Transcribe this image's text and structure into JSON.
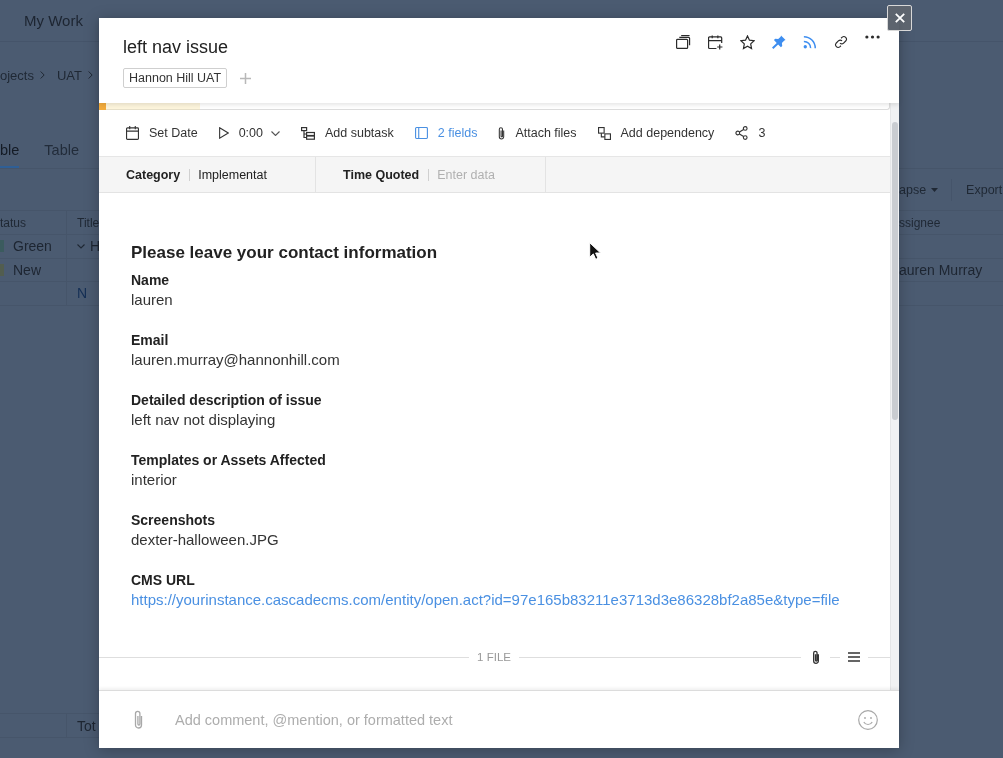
{
  "background_app": {
    "nav_title": "My Work",
    "breadcrumb": [
      "ojects",
      "UAT"
    ],
    "view_tabs": [
      {
        "label": "ble",
        "selected": true
      },
      {
        "label": "Table",
        "selected": false
      }
    ],
    "table_actions": [
      {
        "kind": "dropdown",
        "label": "apse"
      },
      {
        "kind": "button",
        "label": "Export"
      }
    ],
    "columns": [
      "tatus",
      "Title",
      "ssignee"
    ],
    "rows": [
      {
        "status": "Green",
        "color": "#3b5b5e",
        "title": "H",
        "expanded": true
      },
      {
        "status": "New",
        "color": "#525d4f",
        "assignee": "auren Murray"
      }
    ],
    "add_row_link": "N",
    "footer_label": "Tot"
  },
  "task": {
    "title": "left nav issue",
    "tags": [
      "Hannon Hill UAT"
    ],
    "header_actions": [
      {
        "kind": "windows",
        "on": false
      },
      {
        "kind": "calendar_plus",
        "on": false
      },
      {
        "kind": "star",
        "on": false
      },
      {
        "kind": "pin",
        "on": true
      },
      {
        "kind": "feed",
        "on": true
      },
      {
        "kind": "link",
        "on": false
      },
      {
        "kind": "more",
        "on": false
      }
    ],
    "toolbar": [
      {
        "kind": "date",
        "label": "Set Date",
        "on": false
      },
      {
        "kind": "timer",
        "label": "0:00",
        "on": false
      },
      {
        "kind": "subtask",
        "label": "Add subtask",
        "on": false
      },
      {
        "kind": "fields",
        "label": "2 fields",
        "on": true
      },
      {
        "kind": "attach",
        "label": "Attach files",
        "on": false
      },
      {
        "kind": "dependency",
        "label": "Add dependency",
        "on": false
      },
      {
        "kind": "share",
        "label": "3",
        "on": false
      }
    ],
    "custom_fields": [
      {
        "label": "Category",
        "value": "Implementat"
      },
      {
        "label": "Time Quoted",
        "placeholder": "Enter data"
      }
    ],
    "description": {
      "heading": "Please leave your contact information",
      "entries": [
        {
          "kind": "text",
          "label": "Name",
          "value": "lauren"
        },
        {
          "kind": "text",
          "label": "Email",
          "value": "lauren.murray@hannonhill.com"
        },
        {
          "kind": "text",
          "label": "Detailed description of issue",
          "value": "left nav not displaying"
        },
        {
          "kind": "text",
          "label": "Templates or Assets Affected",
          "value": "interior"
        },
        {
          "kind": "text",
          "label": "Screenshots",
          "value": "dexter-halloween.JPG"
        },
        {
          "kind": "link",
          "label": "CMS URL",
          "value": "https://yourinstance.cascadecms.com/entity/open.act?id=97e165b83211e3713d3e86328bf2a85e&type=file"
        }
      ]
    },
    "attachments_label": "1 FILE",
    "comment": {
      "placeholder": "Add comment, @mention, or formatted text"
    }
  }
}
